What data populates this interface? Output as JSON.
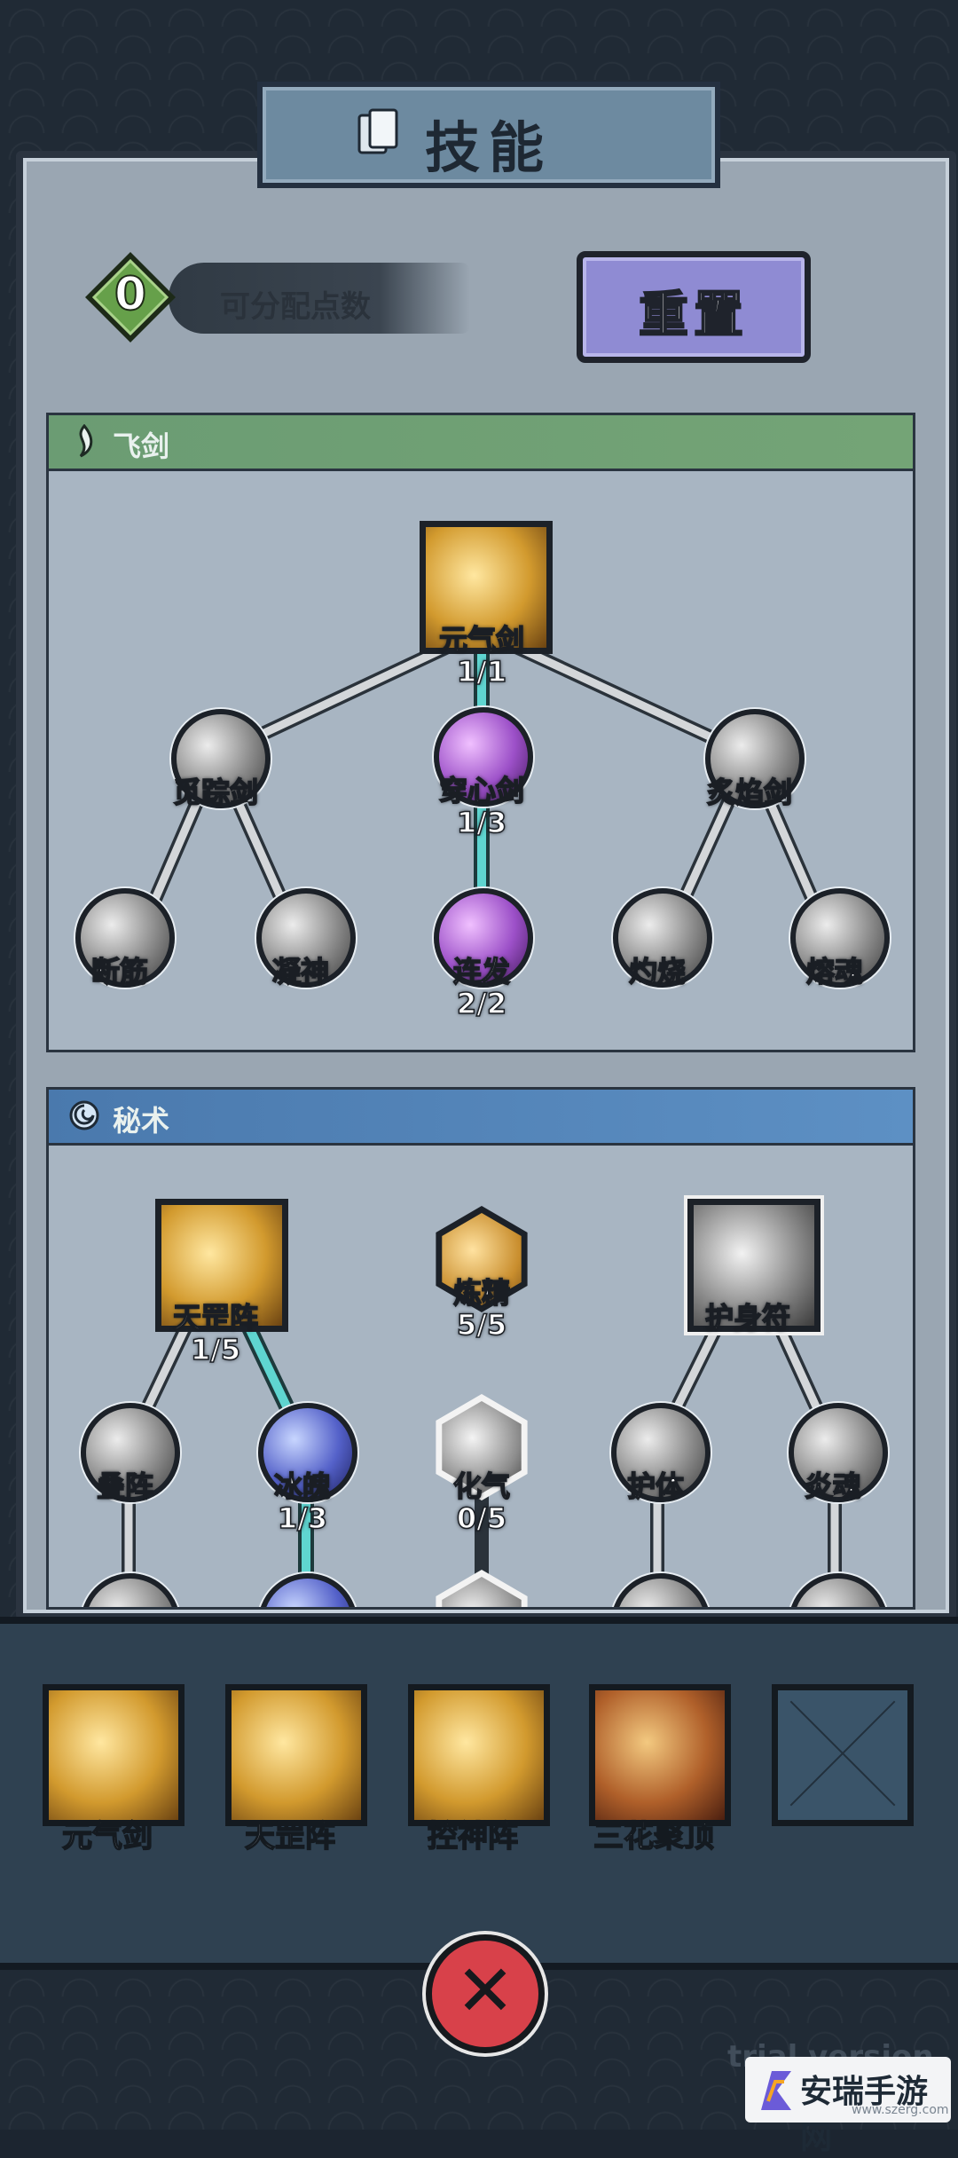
{
  "header": {
    "title": "技能"
  },
  "points": {
    "value": "0",
    "label": "可分配点数"
  },
  "reset": {
    "label": "重置"
  },
  "sections": {
    "sword": {
      "label": "飞剑",
      "nodes": {
        "root": {
          "name": "元气剑",
          "level": "1/1"
        },
        "left": {
          "name": "觅踪剑"
        },
        "center": {
          "name": "穿心剑",
          "level": "1/3"
        },
        "right": {
          "name": "炙焰剑"
        },
        "l1": {
          "name": "断筋"
        },
        "l2": {
          "name": "凝神"
        },
        "c1": {
          "name": "连发",
          "level": "2/2"
        },
        "r1": {
          "name": "灼烧"
        },
        "r2": {
          "name": "熔魂"
        }
      }
    },
    "arcane": {
      "label": "秘术",
      "nodes": {
        "a_root": {
          "name": "天罡阵",
          "level": "1/5"
        },
        "b_root": {
          "name": "炼精",
          "level": "5/5"
        },
        "c_root": {
          "name": "护身符"
        },
        "a1": {
          "name": "叠阵"
        },
        "a2": {
          "name": "冰魄",
          "level": "1/3"
        },
        "b1": {
          "name": "化气",
          "level": "0/5"
        },
        "c1": {
          "name": "护体"
        },
        "c2": {
          "name": "炎魂"
        }
      }
    }
  },
  "equipped": {
    "slots": [
      {
        "label": "元气剑"
      },
      {
        "label": "天罡阵"
      },
      {
        "label": "控神阵"
      },
      {
        "label": "三花聚顶"
      },
      {
        "label": ""
      }
    ]
  },
  "watermark": {
    "text": "安瑞手游网",
    "url": "www.szerg.com",
    "overlay": "trial version"
  },
  "colors": {
    "accent_path": "#5fd5d0",
    "sword_bar": "#6b9c73",
    "arcane_bar": "#4a79ad",
    "reset_button": "#8f8bd3",
    "close_button": "#d8414a"
  }
}
